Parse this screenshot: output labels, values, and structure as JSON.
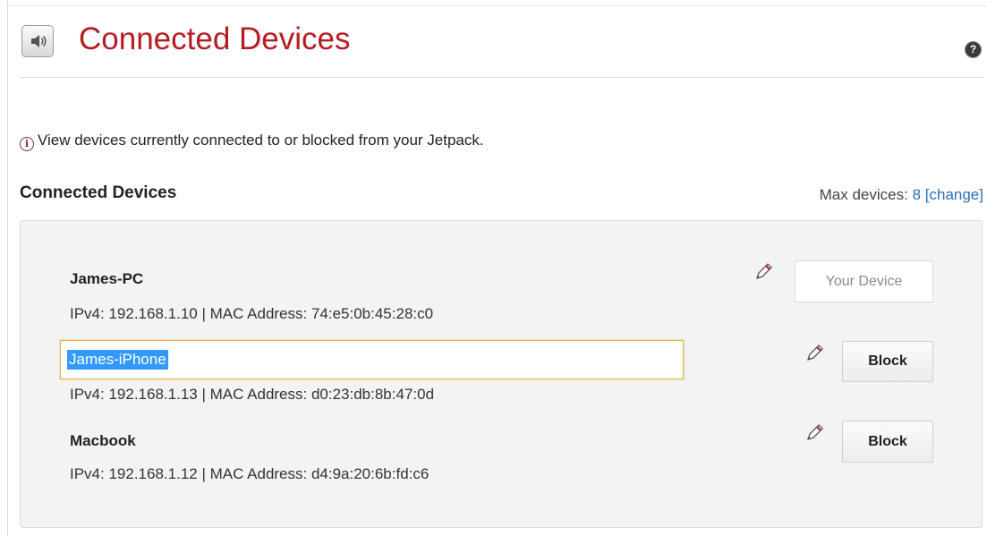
{
  "page": {
    "title": "Connected Devices",
    "help_glyph": "?",
    "info_text": "View devices currently connected to or blocked from your Jetpack.",
    "info_glyph": "i"
  },
  "section": {
    "title": "Connected Devices",
    "max_devices_label": "Max devices:",
    "max_devices_value": "8",
    "change_link": "[change]"
  },
  "devices": [
    {
      "name": "James-PC",
      "meta": "IPv4: 192.168.1.10 | MAC Address: 74:e5:0b:45:28:c0",
      "action_label": "Your Device",
      "editing": false
    },
    {
      "name": "James-iPhone",
      "meta": "IPv4: 192.168.1.13 | MAC Address: d0:23:db:8b:47:0d",
      "action_label": "Block",
      "editing": true
    },
    {
      "name": "Macbook",
      "meta": "IPv4: 192.168.1.12 | MAC Address: d4:9a:20:6b:fd:c6",
      "action_label": "Block",
      "editing": false
    }
  ],
  "icons": {
    "header": "speaker-icon",
    "help": "help-icon",
    "info": "info-icon",
    "edit": "pencil-icon"
  },
  "colors": {
    "title_red": "#b51c22",
    "link_blue": "#2a6ebb",
    "selection_blue": "#3399ff",
    "focus_border": "#e2b24a",
    "panel_bg": "#f3f3f3"
  }
}
